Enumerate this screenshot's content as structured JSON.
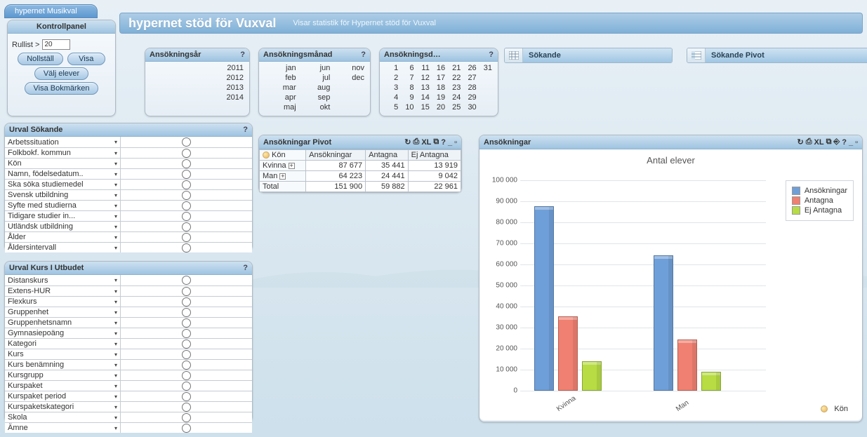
{
  "app_tab": "hypernet Musikval",
  "title_main": "hypernet stöd för Vuxval",
  "title_sub": "Visar statistik för Hypernet stöd för Vuxval",
  "kontroll": {
    "head": "Kontrollpanel",
    "rullist_label": "Rullist >",
    "rullist_value": "20",
    "btn_nollstall": "Nollställ",
    "btn_visa": "Visa",
    "btn_valj": "Välj elever",
    "btn_bokm": "Visa Bokmärken"
  },
  "sel_ar": {
    "head": "Ansökningsår",
    "help": "?",
    "items": [
      "2011",
      "2012",
      "2013",
      "2014"
    ]
  },
  "sel_man": {
    "head": "Ansökningsmånad",
    "help": "?",
    "cols": [
      [
        "jan",
        "feb",
        "mar",
        "apr",
        "maj"
      ],
      [
        "jun",
        "jul",
        "aug",
        "sep",
        "okt"
      ],
      [
        "nov",
        "dec"
      ]
    ]
  },
  "sel_dag": {
    "head": "Ansökningsd…",
    "help": "?",
    "cols": [
      [
        "1",
        "2",
        "3",
        "4",
        "5"
      ],
      [
        "6",
        "7",
        "8",
        "9",
        "10"
      ],
      [
        "11",
        "12",
        "13",
        "14",
        "15"
      ],
      [
        "16",
        "17",
        "18",
        "19",
        "20"
      ],
      [
        "21",
        "22",
        "23",
        "24",
        "25"
      ],
      [
        "26",
        "27",
        "28",
        "29",
        "30"
      ],
      [
        "31"
      ]
    ]
  },
  "sok1": "Sökande",
  "sok2": "Sökande Pivot",
  "urval_sok": {
    "head": "Urval Sökande",
    "help": "?",
    "items": [
      "Arbetssituation",
      "Folkbokf. kommun",
      "Kön",
      "Namn, födelsedatum..",
      "Ska söka studiemedel",
      "Svensk utbildning",
      "Syfte med studierna",
      "Tidigare studier in...",
      "Utländsk utbildning",
      "Ålder",
      "Åldersintervall"
    ]
  },
  "urval_kurs": {
    "head": "Urval Kurs I Utbudet",
    "help": "?",
    "items": [
      "Distanskurs",
      "Extens-HUR",
      "Flexkurs",
      "Gruppenhet",
      "Gruppenhetsnamn",
      "Gymnasiepoäng",
      "Kategori",
      "Kurs",
      "Kurs benämning",
      "Kursgrupp",
      "Kurspaket",
      "Kurspaket period",
      "Kurspaketskategori",
      "Skola",
      "Ämne"
    ]
  },
  "pivot": {
    "head": "Ansökningar Pivot",
    "dim": "Kön",
    "cols": [
      "Ansökningar",
      "Antagna",
      "Ej Antagna"
    ],
    "rows": [
      {
        "label": "Kvinna",
        "v": [
          "87 677",
          "35 441",
          "13 919"
        ]
      },
      {
        "label": "Man",
        "v": [
          "64 223",
          "24 441",
          "9 042"
        ]
      }
    ],
    "total": {
      "label": "Total",
      "v": [
        "151 900",
        "59 882",
        "22 961"
      ]
    }
  },
  "chart": {
    "head": "Ansökningar",
    "title": "Antal elever",
    "legend": [
      "Ansökningar",
      "Antagna",
      "Ej Antagna"
    ],
    "kon_label": "Kön",
    "yticks": [
      "0",
      "10 000",
      "20 000",
      "30 000",
      "40 000",
      "50 000",
      "60 000",
      "70 000",
      "80 000",
      "90 000",
      "100 000"
    ]
  },
  "chart_data": {
    "type": "bar",
    "title": "Antal elever",
    "xlabel": "Kön",
    "ylabel": "",
    "ylim": [
      0,
      100000
    ],
    "categories": [
      "Kvinna",
      "Man"
    ],
    "series": [
      {
        "name": "Ansökningar",
        "values": [
          87677,
          64223
        ]
      },
      {
        "name": "Antagna",
        "values": [
          35441,
          24441
        ]
      },
      {
        "name": "Ej Antagna",
        "values": [
          13919,
          9042
        ]
      }
    ]
  }
}
